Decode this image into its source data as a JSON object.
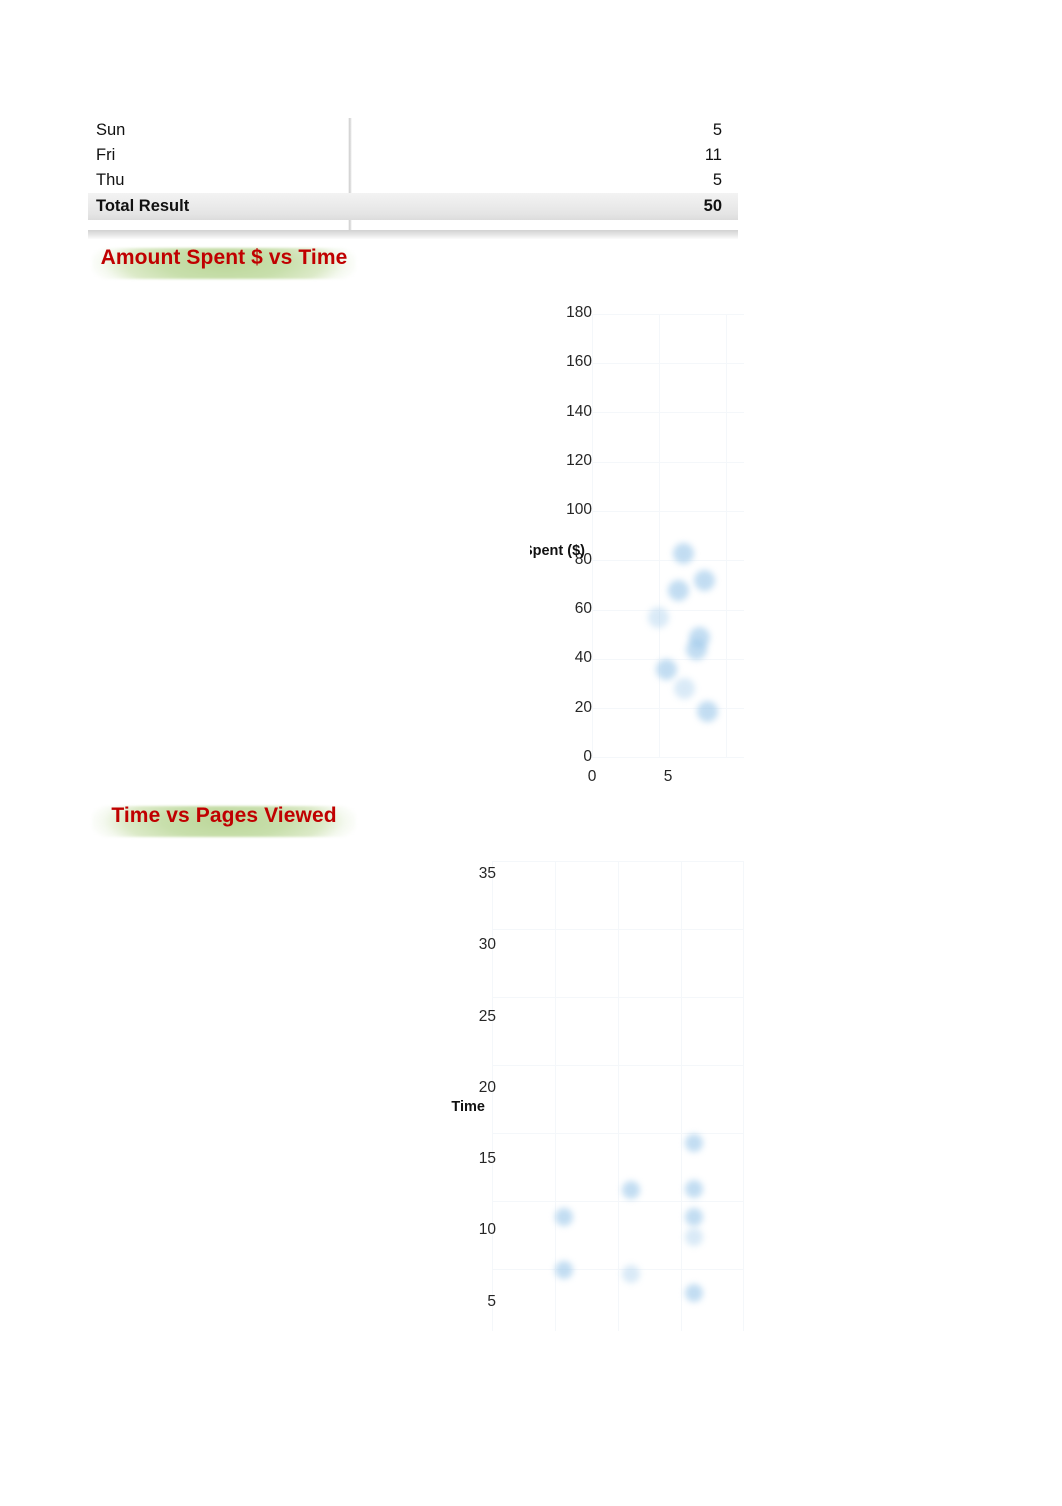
{
  "pivot_table": {
    "rows": [
      {
        "label": "Sun",
        "value": "5"
      },
      {
        "label": "Fri",
        "value": "11"
      },
      {
        "label": "Thu",
        "value": "5"
      }
    ],
    "total": {
      "label": "Total Result",
      "value": "50"
    }
  },
  "titles": {
    "chart1": "Amount Spent $ vs Time",
    "chart2": "Time vs Pages Viewed"
  },
  "colors": {
    "title_text": "#c00000",
    "title_highlight": "#bcd79a",
    "marker": "#9dc8ea",
    "total_row_band": "#e4e4e4"
  },
  "chart_data": [
    {
      "type": "scatter",
      "title": "Amount Spent $ vs Time",
      "xlabel": "",
      "ylabel": "Amount Spent ($)",
      "yticks": [
        0,
        20,
        40,
        60,
        80,
        100,
        120,
        140,
        160,
        180
      ],
      "xticks": [
        0,
        5
      ],
      "xlim": [
        0,
        10
      ],
      "ylim": [
        0,
        180
      ],
      "grid": true,
      "legend": "none",
      "points": [
        {
          "x": 6.0,
          "y": 83
        },
        {
          "x": 7.4,
          "y": 72
        },
        {
          "x": 5.7,
          "y": 68
        },
        {
          "x": 4.4,
          "y": 57
        },
        {
          "x": 7.1,
          "y": 49
        },
        {
          "x": 6.9,
          "y": 44
        },
        {
          "x": 4.9,
          "y": 36
        },
        {
          "x": 6.1,
          "y": 28
        },
        {
          "x": 7.6,
          "y": 19
        }
      ]
    },
    {
      "type": "scatter",
      "title": "Time vs Pages Viewed",
      "xlabel": "",
      "ylabel": "Time",
      "yticks": [
        5,
        10,
        15,
        20,
        25,
        30,
        35
      ],
      "xticks": [],
      "xlim": [
        0,
        4
      ],
      "ylim": [
        3,
        36
      ],
      "grid": true,
      "legend": "none",
      "points": [
        {
          "x": 1.15,
          "y": 11.0
        },
        {
          "x": 1.15,
          "y": 7.3
        },
        {
          "x": 2.2,
          "y": 12.9
        },
        {
          "x": 2.2,
          "y": 7.0
        },
        {
          "x": 3.2,
          "y": 16.2
        },
        {
          "x": 3.2,
          "y": 13.0
        },
        {
          "x": 3.2,
          "y": 11.0
        },
        {
          "x": 3.2,
          "y": 9.6
        },
        {
          "x": 3.2,
          "y": 5.7
        }
      ]
    }
  ]
}
